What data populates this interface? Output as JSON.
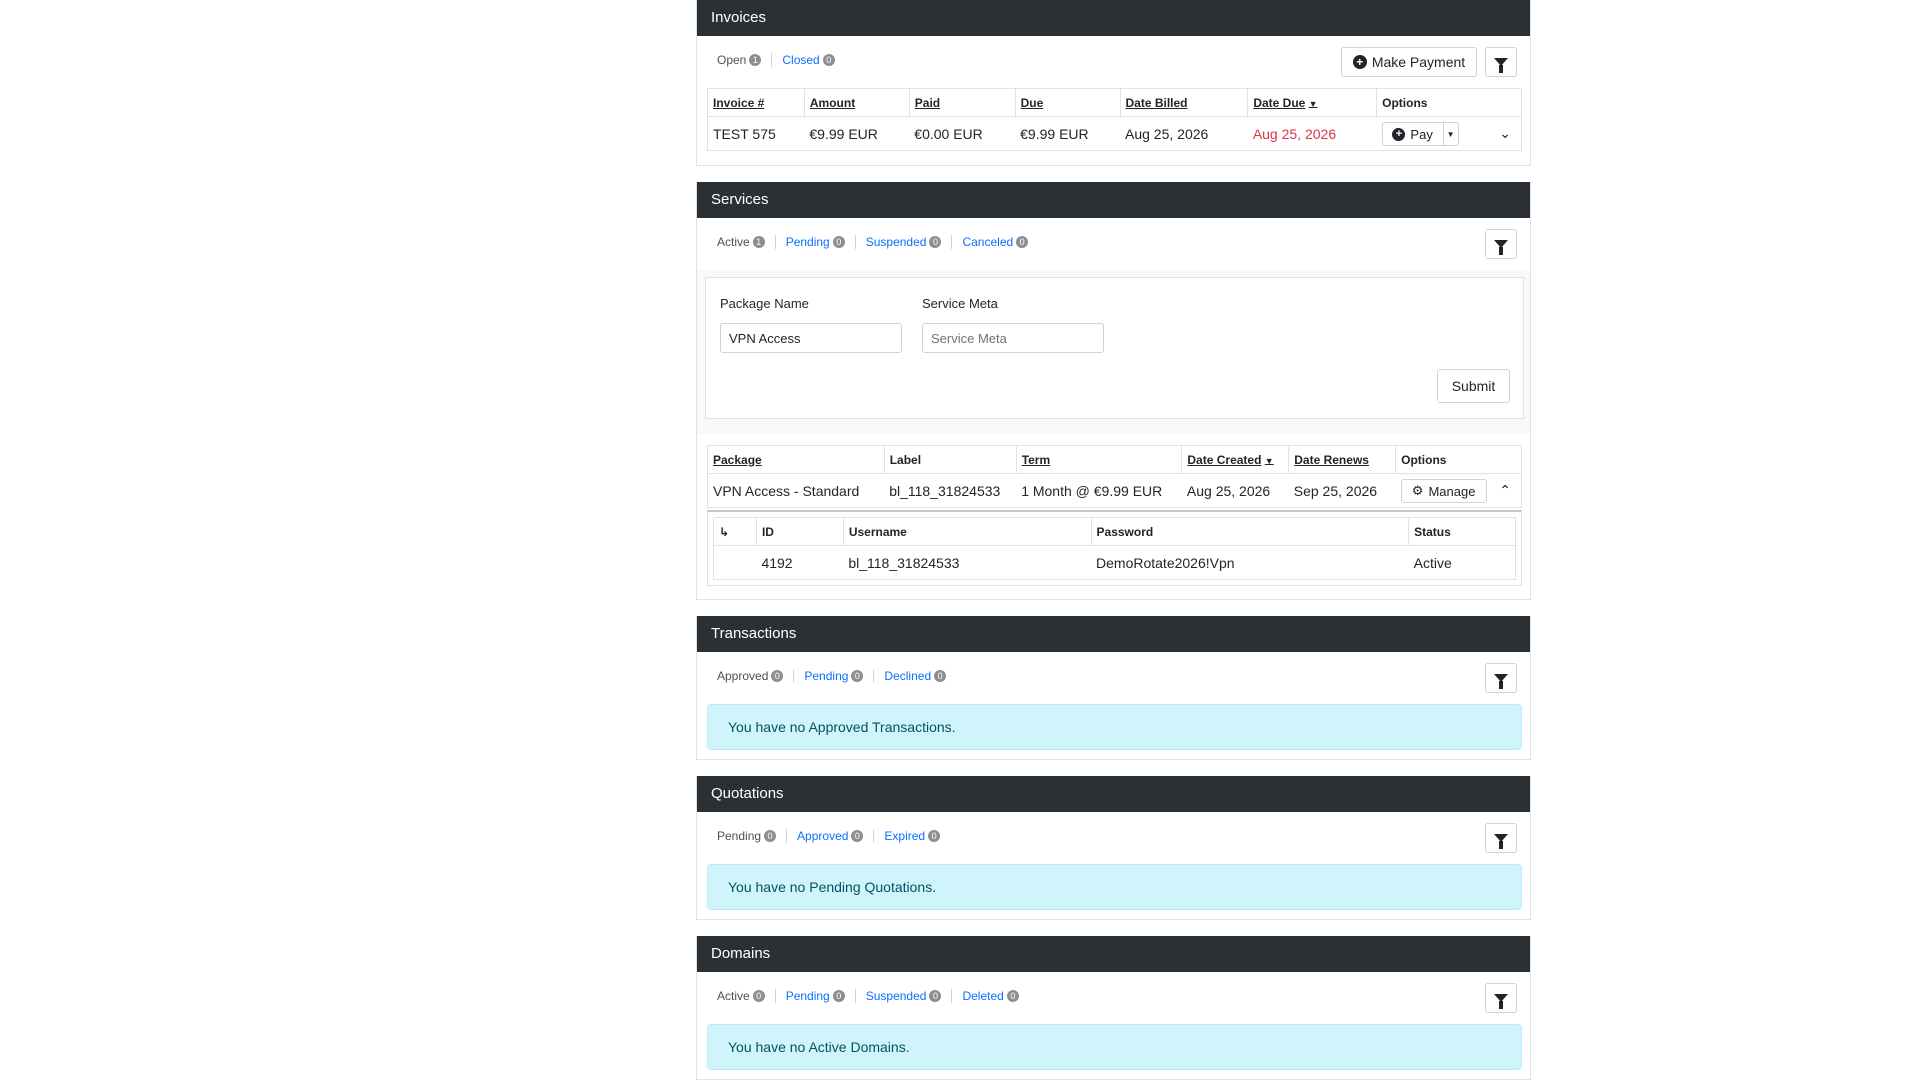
{
  "invoices": {
    "title": "Invoices",
    "tabs": [
      {
        "label": "Open",
        "count": "1"
      },
      {
        "label": "Closed",
        "count": "0"
      }
    ],
    "make_payment_label": "Make Payment",
    "columns": [
      "Invoice #",
      "Amount",
      "Paid",
      "Due",
      "Date Billed",
      "Date Due",
      "Options"
    ],
    "rows": [
      {
        "invoice": "TEST 575",
        "amount": "€9.99 EUR",
        "paid": "€0.00 EUR",
        "due": "€9.99 EUR",
        "date_billed": "Aug 25, 2026",
        "date_due": "Aug 25, 2026",
        "pay_label": "Pay"
      }
    ]
  },
  "services": {
    "title": "Services",
    "tabs": [
      {
        "label": "Active",
        "count": "1"
      },
      {
        "label": "Pending",
        "count": "0"
      },
      {
        "label": "Suspended",
        "count": "0"
      },
      {
        "label": "Canceled",
        "count": "0"
      }
    ],
    "filter_form": {
      "package_name_label": "Package Name",
      "package_name_value": "VPN Access",
      "service_meta_label": "Service Meta",
      "service_meta_placeholder": "Service Meta",
      "submit_label": "Submit"
    },
    "columns": [
      "Package",
      "Label",
      "Term",
      "Date Created",
      "Date Renews",
      "Options"
    ],
    "rows": [
      {
        "package": "VPN Access - Standard",
        "label": "bl_118_31824533",
        "term": "1 Month @ €9.99 EUR",
        "date_created": "Aug 25, 2026",
        "date_renews": "Sep 25, 2026",
        "manage_label": "Manage"
      }
    ],
    "sub_table": {
      "columns": [
        "ID",
        "Username",
        "Password",
        "Status"
      ],
      "rows": [
        {
          "id": "4192",
          "username": "bl_118_31824533",
          "password": "DemoRotate2026!Vpn",
          "status": "Active"
        }
      ]
    }
  },
  "transactions": {
    "title": "Transactions",
    "tabs": [
      {
        "label": "Approved",
        "count": "0"
      },
      {
        "label": "Pending",
        "count": "0"
      },
      {
        "label": "Declined",
        "count": "0"
      }
    ],
    "empty_message": "You have no Approved Transactions."
  },
  "quotations": {
    "title": "Quotations",
    "tabs": [
      {
        "label": "Pending",
        "count": "0"
      },
      {
        "label": "Approved",
        "count": "0"
      },
      {
        "label": "Expired",
        "count": "0"
      }
    ],
    "empty_message": "You have no Pending Quotations."
  },
  "domains": {
    "title": "Domains",
    "tabs": [
      {
        "label": "Active",
        "count": "0"
      },
      {
        "label": "Pending",
        "count": "0"
      },
      {
        "label": "Suspended",
        "count": "0"
      },
      {
        "label": "Deleted",
        "count": "0"
      }
    ],
    "empty_message": "You have no Active Domains."
  },
  "icons": {
    "filter": "filter-icon",
    "plus": "plus-circle-icon",
    "gear": "gear-icon",
    "chevron_down": "chevron-down-icon",
    "chevron_up": "chevron-up-icon",
    "return_arrow": "return-arrow-icon"
  },
  "colors": {
    "panel_header": "#2b3035",
    "link": "#0d6efd",
    "overdue": "#dc3545",
    "alert_bg": "#cff4fc",
    "alert_text": "#055160"
  }
}
